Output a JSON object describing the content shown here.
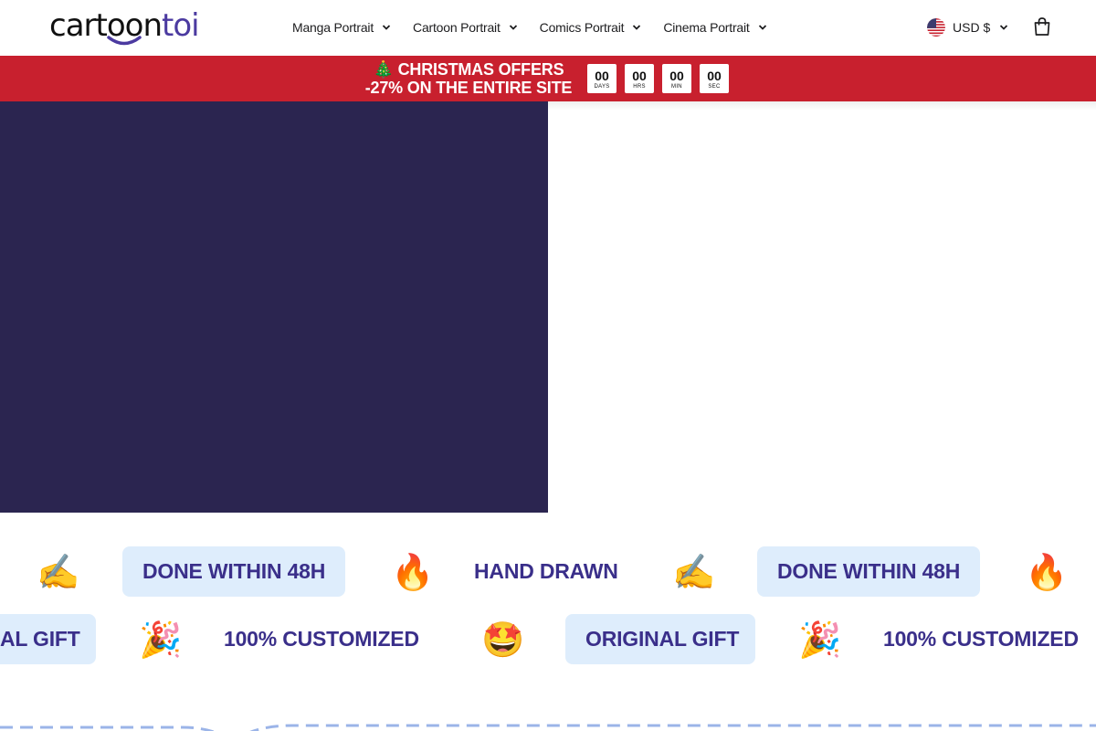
{
  "brand": {
    "logo_part1": "cartoon",
    "logo_part2": "toi"
  },
  "nav": {
    "items": [
      {
        "label": "Manga Portrait"
      },
      {
        "label": "Cartoon Portrait"
      },
      {
        "label": "Comics Portrait"
      },
      {
        "label": "Cinema Portrait"
      }
    ]
  },
  "currency": {
    "label": "USD $"
  },
  "promo": {
    "line1": "🎄 CHRISTMAS OFFERS",
    "line2": "-27% ON THE ENTIRE SITE",
    "countdown": [
      {
        "value": "00",
        "unit": "DAYS"
      },
      {
        "value": "00",
        "unit": "HRS"
      },
      {
        "value": "00",
        "unit": "MIN"
      },
      {
        "value": "00",
        "unit": "SEC"
      }
    ]
  },
  "marquee": {
    "row1": {
      "emoji1": "✍️",
      "pill1": "DONE WITHIN 48H",
      "emoji2": "🔥",
      "text1": "HAND DRAWN",
      "emoji3": "✍️",
      "pill2": "DONE WITHIN 48H",
      "emoji4": "🔥"
    },
    "row2": {
      "pill1": "AL GIFT",
      "emoji1": "🎉",
      "text1": "100% CUSTOMIZED",
      "emoji2": "🤩",
      "pill2": "ORIGINAL GIFT",
      "emoji3": "🎉",
      "text2": "100% CUSTOMIZED"
    }
  },
  "colors": {
    "promo_bg": "#c8202e",
    "hero_bg": "#2b2550",
    "pill_bg": "#deedfc",
    "marquee_text": "#3a2f8a",
    "brand_accent": "#4b3aa0"
  }
}
